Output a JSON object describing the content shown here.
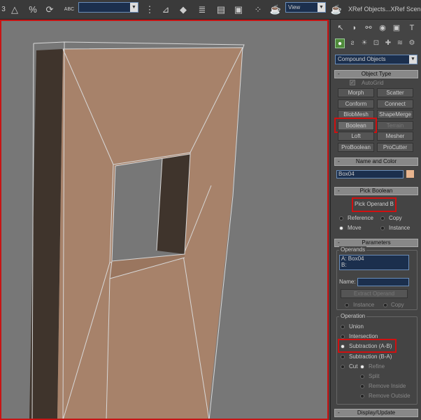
{
  "toolbar": {
    "icons": [
      "snap-3d-icon",
      "angle-snap-icon",
      "percent-snap-icon",
      "spinner-snap-icon",
      "edit-named-selection-icon",
      "named-selection-set",
      "mirror-icon",
      "align-icon",
      "layer-manager-icon",
      "graph-editor-icon",
      "schematic-view-icon",
      "material-editor-icon",
      "render-setup-icon",
      "render-icon"
    ],
    "named_selection_value": "",
    "render_dropdown_value": "View",
    "xref_text": "XRef Objects...XRef Scene...",
    "snap_label": "3",
    "abc_label": "ABC"
  },
  "command_panel": {
    "tabs": [
      "create-tab",
      "modify-tab",
      "hierarchy-tab",
      "motion-tab",
      "display-tab",
      "utilities-tab"
    ],
    "subtabs": [
      "geometry-tab",
      "shapes-tab",
      "lights-tab",
      "cameras-tab",
      "helpers-tab",
      "space-warps-tab",
      "systems-tab"
    ],
    "category_dropdown": "Compound Objects",
    "object_type": {
      "title": "Object Type",
      "autogrid_label": "AutoGrid",
      "buttons": [
        "Morph",
        "Scatter",
        "Conform",
        "Connect",
        "BlobMesh",
        "ShapeMerge",
        "Boolean",
        "Terrain",
        "Loft",
        "Mesher",
        "ProBoolean",
        "ProCutter"
      ]
    },
    "name_color": {
      "title": "Name and Color",
      "name_value": "Box04",
      "color": "#e8b48e"
    },
    "pick_boolean": {
      "title": "Pick Boolean",
      "pick_button": "Pick Operand B",
      "options": [
        "Reference",
        "Copy",
        "Move",
        "Instance"
      ],
      "selected": "Move"
    },
    "parameters": {
      "title": "Parameters",
      "operands_label": "Operands",
      "operands": [
        "A: Box04",
        "B:"
      ],
      "name_label": "Name:",
      "name_value": "",
      "extract_button": "Extract Operand",
      "extract_options": [
        "Instance",
        "Copy"
      ],
      "operation_label": "Operation",
      "operations": [
        "Union",
        "Intersection",
        "Subtraction (A-B)",
        "Subtraction (B-A)",
        "Cut"
      ],
      "selected_operation": "Subtraction (A-B)",
      "cut_options": [
        "Refine",
        "Split",
        "Remove Inside",
        "Remove Outside"
      ]
    },
    "display_update": {
      "title": "Display/Update"
    }
  },
  "colors": {
    "viewport_bg": "#777777",
    "object_face": "#a7826a",
    "object_dark": "#3f342c",
    "highlight_red": "#d01010"
  }
}
